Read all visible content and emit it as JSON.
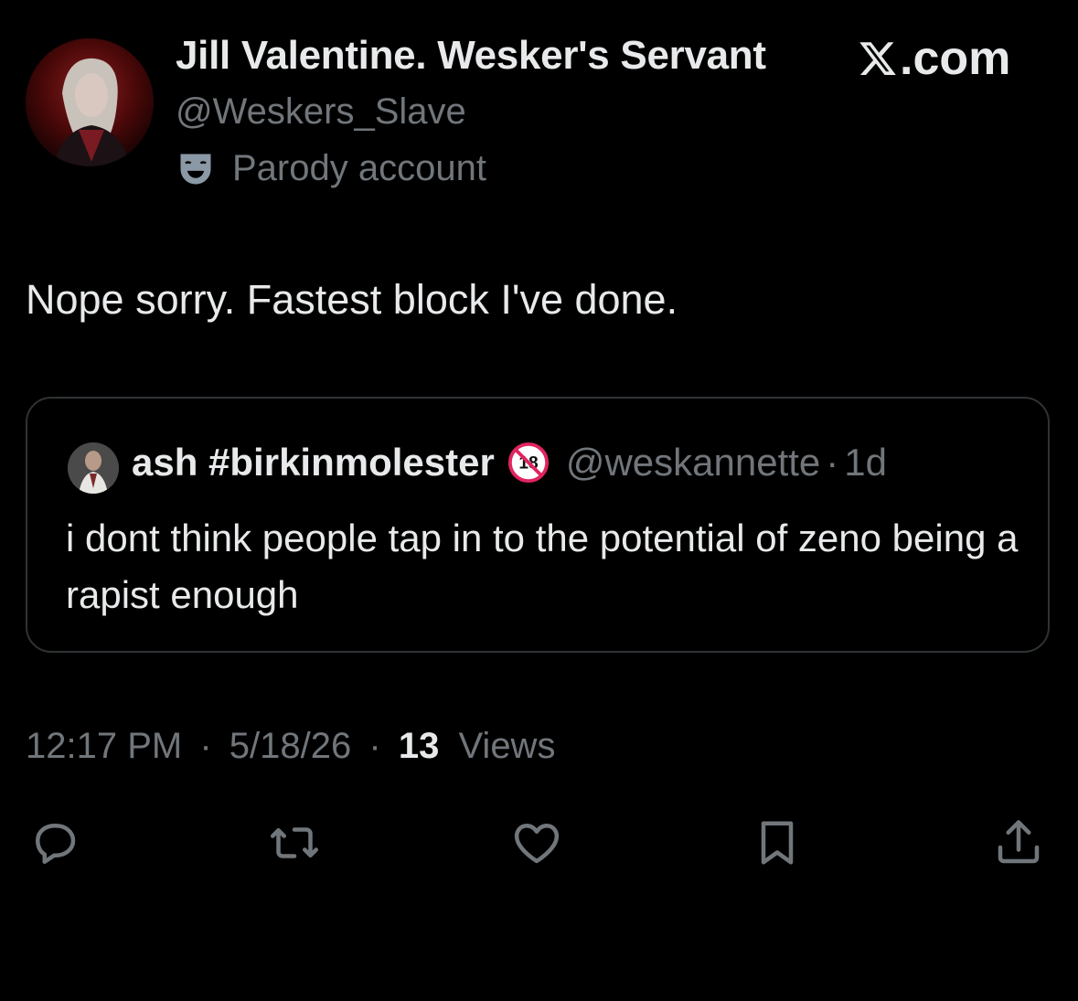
{
  "author": {
    "display_name": "Jill Valentine. Wesker's Servant",
    "handle": "@Weskers_Slave",
    "label": "Parody account",
    "avatar": "profile-avatar"
  },
  "brand": {
    "text": ".com",
    "icon": "x-logo-icon"
  },
  "tweet": {
    "text": "Nope sorry. Fastest block I've done."
  },
  "quoted": {
    "display_name": "ash #birkinmolester",
    "badge": "no-under-18-icon",
    "handle": "@weskannette",
    "separator": "·",
    "time": "1d",
    "text": "i dont think people tap in to the potential of zeno being a rapist enough"
  },
  "meta": {
    "time": "12:17 PM",
    "separator": "·",
    "date": "5/18/26",
    "views_count": "13",
    "views_label": "Views"
  },
  "actions": {
    "reply": "reply-icon",
    "repost": "repost-icon",
    "like": "like-icon",
    "bookmark": "bookmark-icon",
    "share": "share-icon"
  },
  "colors": {
    "background": "#000000",
    "primary_text": "#e7e9ea",
    "secondary_text": "#71767b",
    "border": "#2f3336",
    "no18_red": "#e0245e"
  }
}
